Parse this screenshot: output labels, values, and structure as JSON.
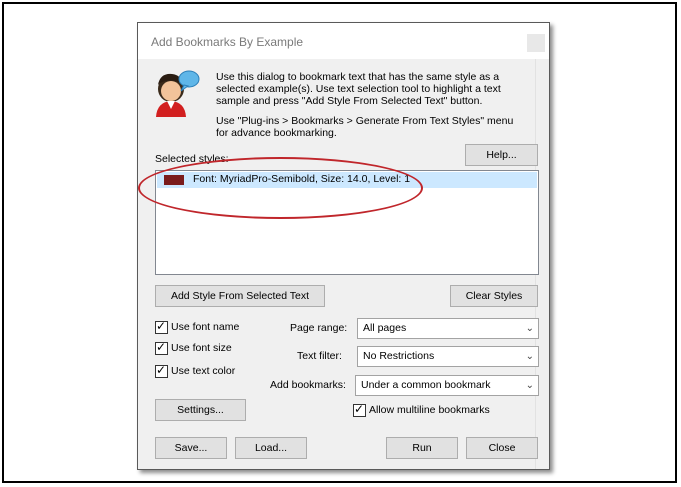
{
  "dialog": {
    "title": "Add Bookmarks By Example",
    "intro": "Use this dialog to bookmark text that has the same style as a selected example(s). Use text selection tool to highlight a text sample and press \"Add Style From Selected Text\" button.",
    "intro2": "Use \"Plug-ins > Bookmarks > Generate From Text Styles\" menu for advance bookmarking.",
    "help_label": "Help...",
    "selected_styles_label": "Selected styles:",
    "styles": [
      {
        "text": "Font: MyriadPro-Semibold, Size: 14.0, Level: 1",
        "color": "#7a1c1c"
      }
    ],
    "add_style_label": "Add Style From Selected Text",
    "clear_styles_label": "Clear Styles",
    "options": {
      "use_font_name": {
        "label": "Use font name",
        "checked": true
      },
      "use_font_size": {
        "label": "Use font size",
        "checked": true
      },
      "use_text_color": {
        "label": "Use text color",
        "checked": true
      }
    },
    "page_range": {
      "label": "Page range:",
      "value": "All pages"
    },
    "text_filter": {
      "label": "Text filter:",
      "value": "No Restrictions"
    },
    "add_bookmarks": {
      "label": "Add bookmarks:",
      "value": "Under a common bookmark"
    },
    "settings_label": "Settings...",
    "allow_multiline": {
      "label": "Allow multiline bookmarks",
      "checked": true
    },
    "save_label": "Save...",
    "load_label": "Load...",
    "run_label": "Run",
    "close_label": "Close"
  },
  "colors": {
    "highlight_ellipse": "#c0262b",
    "selected_row": "#cce8ff"
  }
}
